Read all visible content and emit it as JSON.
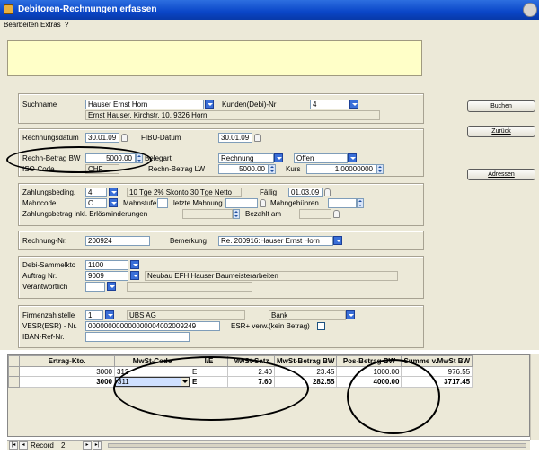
{
  "window": {
    "title": "Debitoren-Rechnungen erfassen"
  },
  "menu": {
    "items": [
      "Bearbeiten",
      "Extras",
      "?"
    ]
  },
  "buttons": {
    "buchen": "Buchen",
    "zurueck": "Zurück",
    "adressen": "Adressen"
  },
  "customer": {
    "suchname_label": "Suchname",
    "suchname_value": "Hauser Ernst Horn",
    "address": "Ernst Hauser, Kirchstr. 10, 9326 Horn",
    "kunden_label": "Kunden(Debi)-Nr",
    "kunden_value": "4"
  },
  "invoice": {
    "rechnungsdatum_label": "Rechnungsdatum",
    "rechnungsdatum_value": "30.01.09",
    "fibu_label": "FIBU-Datum",
    "fibu_value": "30.01.09",
    "betrag_bw_label": "Rechn-Betrag BW",
    "betrag_bw_value": "5000.00",
    "belegart_label": "Belegart",
    "belegart_value": "Rechnung",
    "status_value": "Offen",
    "iso_label": "ISO-Code",
    "iso_value": "CHF",
    "betrag_lw_label": "Rechn-Betrag LW",
    "betrag_lw_value": "5000.00",
    "kurs_label": "Kurs",
    "kurs_value": "1.00000000"
  },
  "payment": {
    "zahlungsbeding_label": "Zahlungsbeding.",
    "zahlungsbeding_value": "4",
    "zahlungsbeding_text": "10 Tge 2% Skonto 30 Tge Netto",
    "faellig_label": "Fällig",
    "faellig_value": "01.03.09",
    "mahncode_label": "Mahncode",
    "mahncode_value": "O",
    "mahnstufe_label": "Mahnstufe",
    "letzte_mahnung_label": "letzte Mahnung",
    "mahngebuehren_label": "Mahngebühren",
    "zahlungsbetrag_label": "Zahlungsbetrag inkl. Erlösminderungen",
    "bezahlt_am_label": "Bezahlt am"
  },
  "reference": {
    "rechnung_nr_label": "Rechnung-Nr.",
    "rechnung_nr_value": "200924",
    "bemerkung_label": "Bemerkung",
    "bemerkung_value": "Re. 200916:Hauser Ernst Horn"
  },
  "accounting": {
    "sammelkto_label": "Debi-Sammelkto",
    "sammelkto_value": "1100",
    "auftrag_label": "Auftrag Nr.",
    "auftrag_value": "9009",
    "auftrag_text": "Neubau EFH Hauser Baumeisterarbeiten",
    "verantwortlich_label": "Verantwortlich"
  },
  "bank": {
    "firmenzahlstelle_label": "Firmenzahlstelle",
    "firmenzahlstelle_value": "1",
    "bank_name": "UBS AG",
    "bank_type": "Bank",
    "vesr_label": "VESR(ESR) - Nr.",
    "vesr_value": "000000000000000004002009249",
    "esr_verw_label": "ESR+ verw.(kein Betrag)",
    "iban_label": "IBAN-Ref-Nr."
  },
  "grid": {
    "headers": [
      "Ertrag-Kto.",
      "MwSt-Code",
      "I/E",
      "MwSt-Satz",
      "MwSt-Betrag BW",
      "Pos-Betrag BW",
      "Summe v.MwSt BW"
    ],
    "rows": [
      [
        "3000",
        "312",
        "E",
        "2.40",
        "23.45",
        "1000.00",
        "976.55"
      ],
      [
        "3000",
        "311",
        "E",
        "7.60",
        "282.55",
        "4000.00",
        "3717.45"
      ]
    ]
  },
  "status": {
    "record_label": "Record",
    "record_value": "2"
  }
}
